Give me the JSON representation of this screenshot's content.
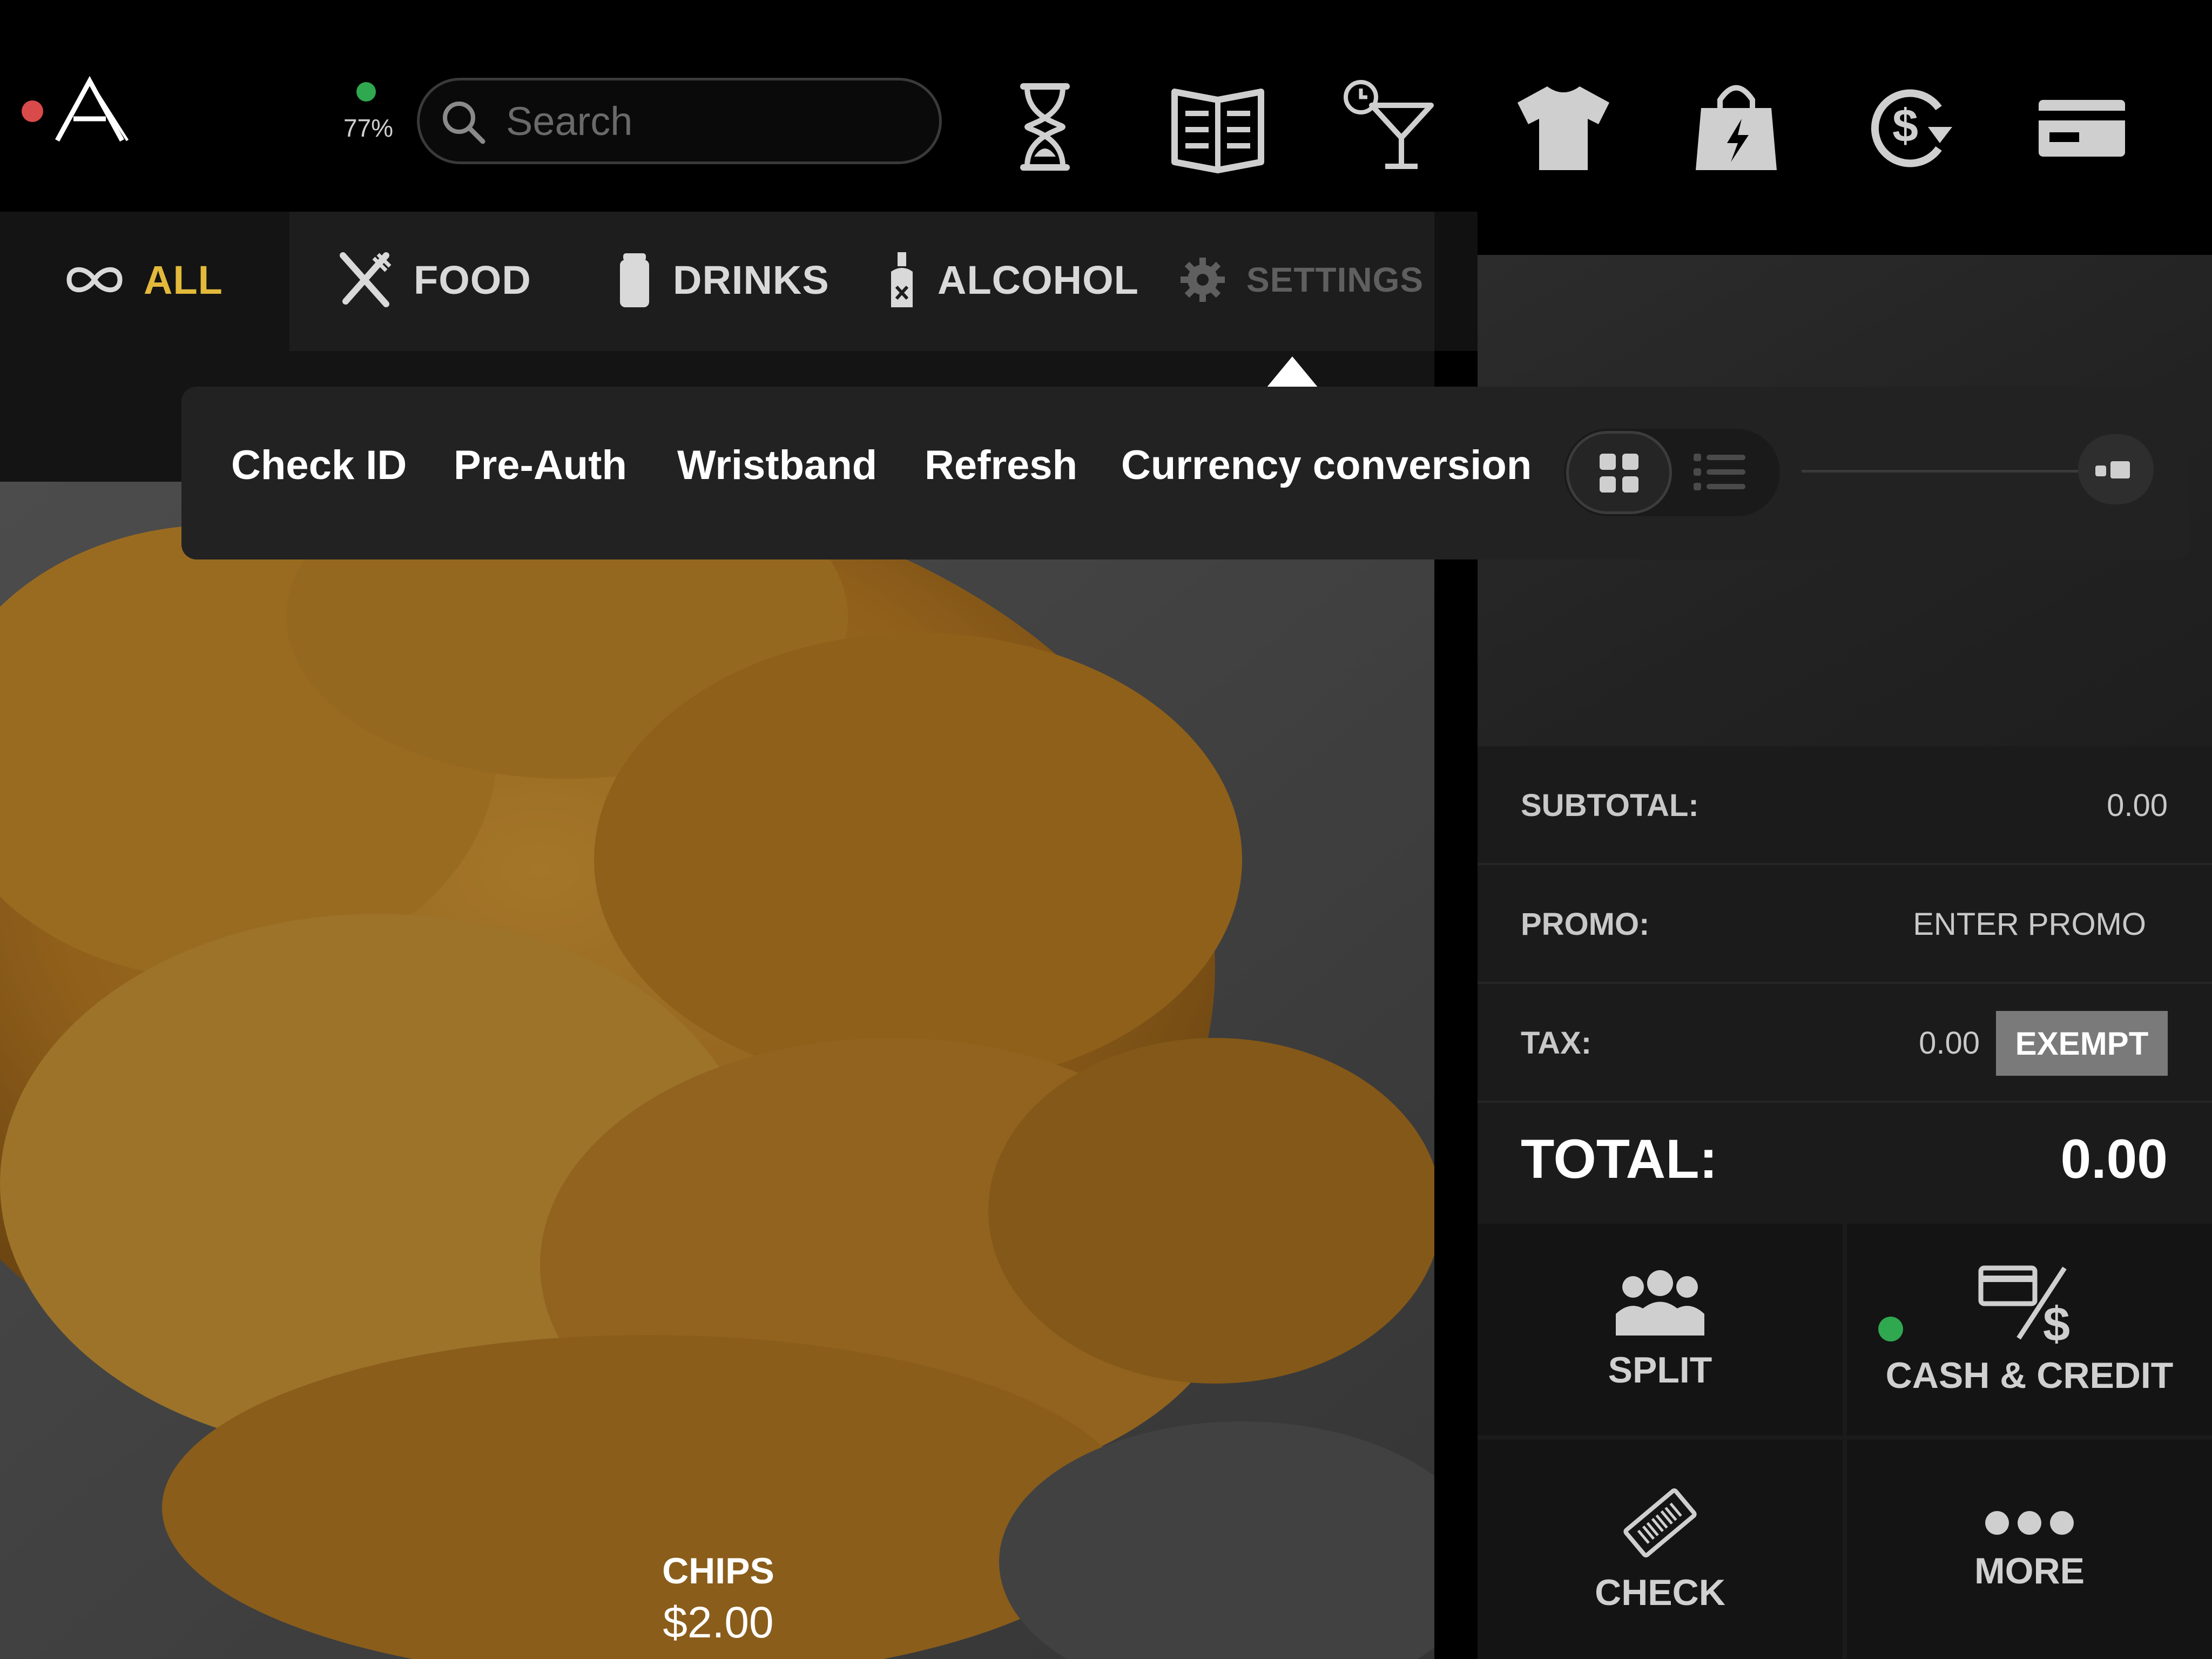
{
  "status": {
    "battery": "77%",
    "indicator_color": "#d94a4a",
    "battery_color": "#2fa84f"
  },
  "search": {
    "placeholder": "Search"
  },
  "toolbar": {
    "icons": [
      "hourglass-icon",
      "menu-book-icon",
      "happy-hour-cocktail-icon",
      "tshirt-merch-icon",
      "shopping-bag-bolt-icon",
      "refund-dollar-icon",
      "credit-card-icon"
    ]
  },
  "categories": {
    "all": "ALL",
    "food": "FOOD",
    "drinks": "DRINKS",
    "alcohol": "ALCOHOL",
    "settings": "SETTINGS",
    "active_color": "#e3b93b"
  },
  "popover": {
    "items": [
      "Check ID",
      "Pre-Auth",
      "Wristband",
      "Refresh",
      "Currency conversion"
    ],
    "view_mode": "grid"
  },
  "product": {
    "name": "CHIPS",
    "price": "$2.00"
  },
  "totals": {
    "subtotal_label": "SUBTOTAL:",
    "subtotal_value": "0.00",
    "promo_label": "PROMO:",
    "promo_action": "ENTER PROMO",
    "tax_label": "TAX:",
    "tax_value": "0.00",
    "exempt_label": "EXEMPT",
    "total_label": "TOTAL:",
    "total_value": "0.00"
  },
  "actions": {
    "split": "SPLIT",
    "cash_credit": "CASH & CREDIT",
    "check": "CHECK",
    "more": "MORE"
  }
}
